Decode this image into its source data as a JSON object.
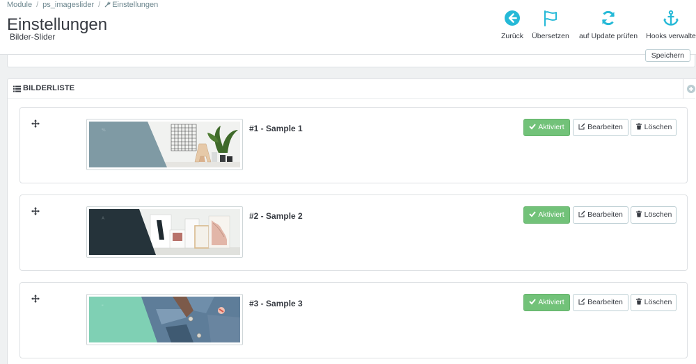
{
  "breadcrumb": {
    "items": [
      "Module",
      "ps_imageslider",
      "Einstellungen"
    ],
    "separator": "/"
  },
  "header": {
    "title": "Einstellungen",
    "subtitle": "Bilder-Slider"
  },
  "toolbar": {
    "back_label": "Zurück",
    "translate_label": "Übersetzen",
    "update_label": "auf Update prüfen",
    "hooks_label": "Hooks verwalte"
  },
  "config_panel": {
    "save_label": "Speichern"
  },
  "slides_panel": {
    "title": "BILDERLISTE",
    "slides": [
      {
        "title": "#1 - Sample 1",
        "status_label": "Aktiviert",
        "edit_label": "Bearbeiten",
        "delete_label": "Löschen"
      },
      {
        "title": "#2 - Sample 2",
        "status_label": "Aktiviert",
        "edit_label": "Bearbeiten",
        "delete_label": "Löschen"
      },
      {
        "title": "#3 - Sample 3",
        "status_label": "Aktiviert",
        "edit_label": "Bearbeiten",
        "delete_label": "Löschen"
      }
    ]
  },
  "icons": {
    "back": "arrow-circle-left-icon",
    "translate": "flag-icon",
    "update": "refresh-icon",
    "hooks": "anchor-icon",
    "list": "list-icon",
    "add": "plus-circle-icon",
    "drag": "move-arrows-icon",
    "active": "check-icon",
    "edit": "edit-icon",
    "delete": "trash-icon"
  },
  "colors": {
    "toolbar_icon": "#25b9d7",
    "active_button": "#72c279",
    "text": "#363a41"
  }
}
